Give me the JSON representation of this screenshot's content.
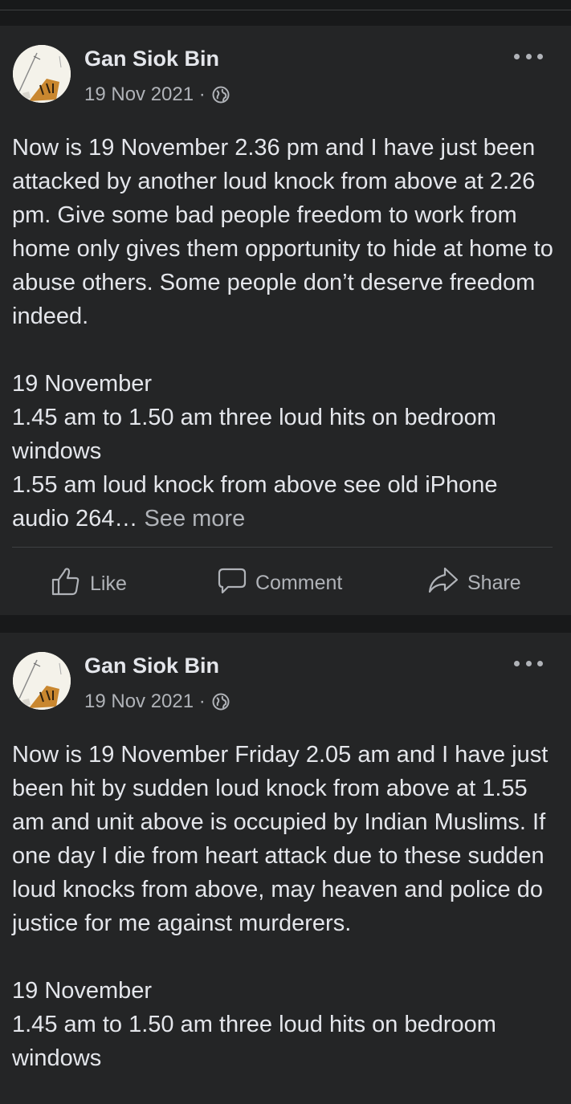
{
  "posts": [
    {
      "author": "Gan Siok Bin",
      "date": "19 Nov 2021 ·",
      "paragraphs": [
        "Now is 19 November 2.36 pm and I have just been attacked by another loud knock from above at 2.26 pm. Give some bad people freedom to work from home only gives them opportunity to hide at home to abuse others. Some people don’t deserve freedom indeed."
      ],
      "lines": [
        "19 November",
        "1.45 am to 1.50 am three loud hits on bedroom windows",
        "1.55 am loud knock from above see old iPhone audio 264…"
      ],
      "see_more": "See more",
      "actions": {
        "like": "Like",
        "comment": "Comment",
        "share": "Share"
      }
    },
    {
      "author": "Gan Siok Bin",
      "date": "19 Nov 2021 ·",
      "paragraphs": [
        "Now is 19 November Friday 2.05 am and I have just been hit by sudden loud knock from above at 1.55 am and unit above is occupied by Indian Muslims. If one day I die from heart attack due to these sudden loud knocks from above, may heaven and police do justice for me against murderers."
      ],
      "lines": [
        "19 November",
        "1.45 am to 1.50 am three loud hits on bedroom windows"
      ]
    }
  ],
  "icons": {
    "privacy": "globe-icon",
    "menu": "more-options-icon",
    "like": "thumbs-up-icon",
    "comment": "comment-bubble-icon",
    "share": "share-arrow-icon"
  },
  "colors": {
    "background": "#18191a",
    "card": "#242526",
    "text_primary": "#e4e6eb",
    "text_secondary": "#b0b3b8"
  }
}
